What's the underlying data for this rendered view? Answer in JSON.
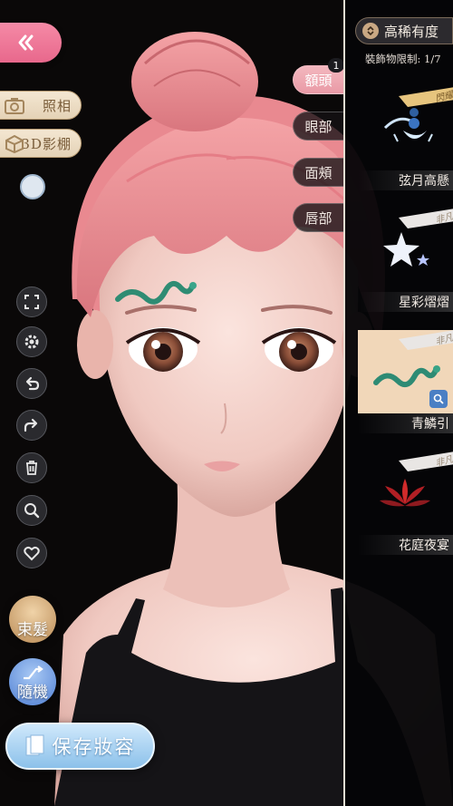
{
  "nav": {
    "back_icon": "double-chevron-left-icon"
  },
  "camera": {
    "photo_label": "照相",
    "studio_label": "3D影棚"
  },
  "tools": [
    {
      "name": "fullscreen",
      "icon": "fullscreen-icon"
    },
    {
      "name": "settings",
      "icon": "gear-icon"
    },
    {
      "name": "undo",
      "icon": "undo-icon"
    },
    {
      "name": "redo",
      "icon": "redo-icon"
    },
    {
      "name": "delete",
      "icon": "trash-icon"
    },
    {
      "name": "zoom",
      "icon": "magnifier-icon"
    },
    {
      "name": "favorite",
      "icon": "heart-icon"
    }
  ],
  "actions": {
    "hair_tie_label": "束髮",
    "random_label": "隨機",
    "save_label": "保存妝容"
  },
  "tabs": [
    {
      "label": "額頭",
      "active": true,
      "badge": "1"
    },
    {
      "label": "眼部",
      "active": false
    },
    {
      "label": "面頰",
      "active": false
    },
    {
      "label": "唇部",
      "active": false
    }
  ],
  "panel": {
    "sort_label": "高稀有度",
    "limit_text": "裝飾物限制: 1/7",
    "items": [
      {
        "name": "弦月高懸",
        "rarity": "閃耀",
        "selected": false
      },
      {
        "name": "星彩熠熠",
        "rarity": "非凡",
        "selected": false
      },
      {
        "name": "青鱗引",
        "rarity": "非凡",
        "selected": true
      },
      {
        "name": "花庭夜宴",
        "rarity": "非凡",
        "selected": false
      }
    ]
  },
  "colors": {
    "accent_pink": "#e8688c",
    "panel_bg": "#050507",
    "save_blue": "#8cc1ea"
  }
}
